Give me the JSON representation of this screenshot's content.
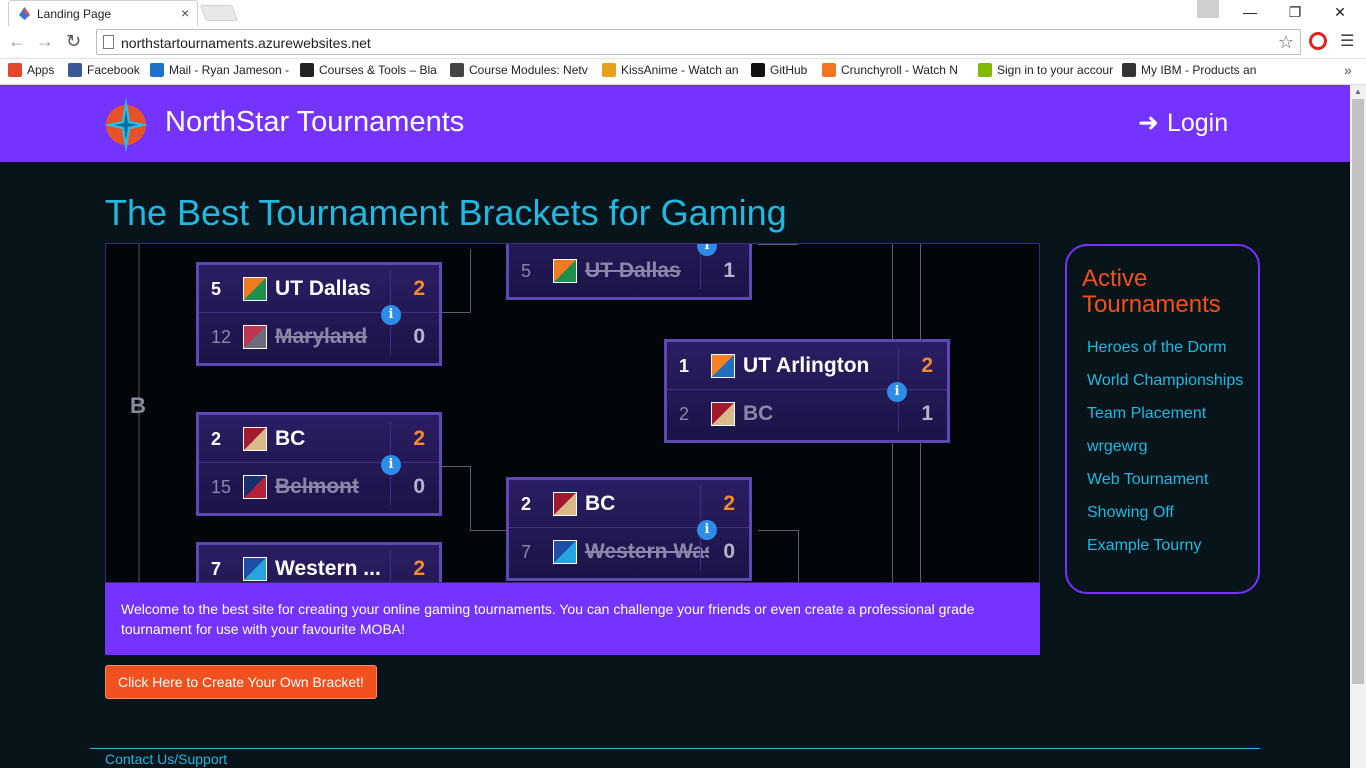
{
  "browser": {
    "tab_title": "Landing Page",
    "close_glyph": "×",
    "url": "northstartournaments.azurewebsites.net",
    "bookmarks": [
      {
        "label": "Apps",
        "icon": "apps-grid-icon",
        "color": "#e2462c"
      },
      {
        "label": "Facebook",
        "icon": "facebook-icon",
        "color": "#3b5998"
      },
      {
        "label": "Mail - Ryan Jameson -",
        "icon": "mail-icon",
        "color": "#1a73c8"
      },
      {
        "label": "Courses & Tools – Bla",
        "icon": "blackboard-icon",
        "color": "#222222"
      },
      {
        "label": "Course Modules: Netv",
        "icon": "cisco-icon",
        "color": "#444444"
      },
      {
        "label": "KissAnime - Watch an",
        "icon": "kissanime-icon",
        "color": "#e6a11c"
      },
      {
        "label": "GitHub",
        "icon": "github-icon",
        "color": "#111111"
      },
      {
        "label": "Crunchyroll - Watch N",
        "icon": "crunchyroll-icon",
        "color": "#f47521"
      },
      {
        "label": "Sign in to your accour",
        "icon": "microsoft-icon",
        "color": "#7fba00"
      },
      {
        "label": "My IBM - Products an",
        "icon": "ibm-icon",
        "color": "#333333"
      }
    ]
  },
  "header": {
    "brand": "NorthStar Tournaments",
    "login": "Login",
    "color": "#7533ff"
  },
  "main": {
    "heading": "The Best Tournament Brackets for Gaming",
    "caption": "Welcome to the best site for creating your online gaming tournaments. You can challenge your friends or even create a professional grade tournament for use with your favourite MOBA!",
    "cta": "Click Here to Create Your Own Bracket!",
    "bracket_label": "B"
  },
  "bracket": {
    "matches": [
      {
        "top": {
          "seed": "5",
          "team": "UT Dallas",
          "score": "2",
          "flag": [
            "#f07c20",
            "#1e8f4e"
          ]
        },
        "bottom": {
          "seed": "12",
          "team": "Maryland",
          "score": "0",
          "flag": [
            "#c0344f",
            "#6c6c7c"
          ]
        }
      },
      {
        "top": {
          "seed": "2",
          "team": "BC",
          "score": "2",
          "flag": [
            "#a3192e",
            "#d9b98a"
          ]
        },
        "bottom": {
          "seed": "15",
          "team": "Belmont",
          "score": "0",
          "flag": [
            "#1a2f6e",
            "#b3213b"
          ]
        }
      },
      {
        "top": {
          "seed": "7",
          "team": "Western ...",
          "score": "2",
          "flag": [
            "#1d4fa8",
            "#27a4e0"
          ]
        }
      },
      {
        "bottom": {
          "seed": "5",
          "team": "UT Dallas",
          "score": "1",
          "flag": [
            "#f07c20",
            "#1e8f4e"
          ]
        }
      },
      {
        "top": {
          "seed": "1",
          "team": "UT Arlington",
          "score": "2",
          "flag": [
            "#f58220",
            "#1e6fc0"
          ]
        },
        "bottom": {
          "seed": "2",
          "team": "BC",
          "score": "1",
          "flag": [
            "#a3192e",
            "#d9b98a"
          ]
        }
      },
      {
        "top": {
          "seed": "2",
          "team": "BC",
          "score": "2",
          "flag": [
            "#a3192e",
            "#d9b98a"
          ]
        },
        "bottom": {
          "seed": "7",
          "team": "Western Was",
          "score": "0",
          "flag": [
            "#1d4fa8",
            "#27a4e0"
          ]
        }
      }
    ]
  },
  "sidebar": {
    "heading": "Active Tournaments",
    "items": [
      "Heroes of the Dorm",
      "World Championships",
      "Team Placement",
      "wrgewrg",
      "Web Tournament",
      "Showing Off",
      "Example Tourny"
    ]
  },
  "footer": {
    "link": "Contact Us/Support"
  }
}
